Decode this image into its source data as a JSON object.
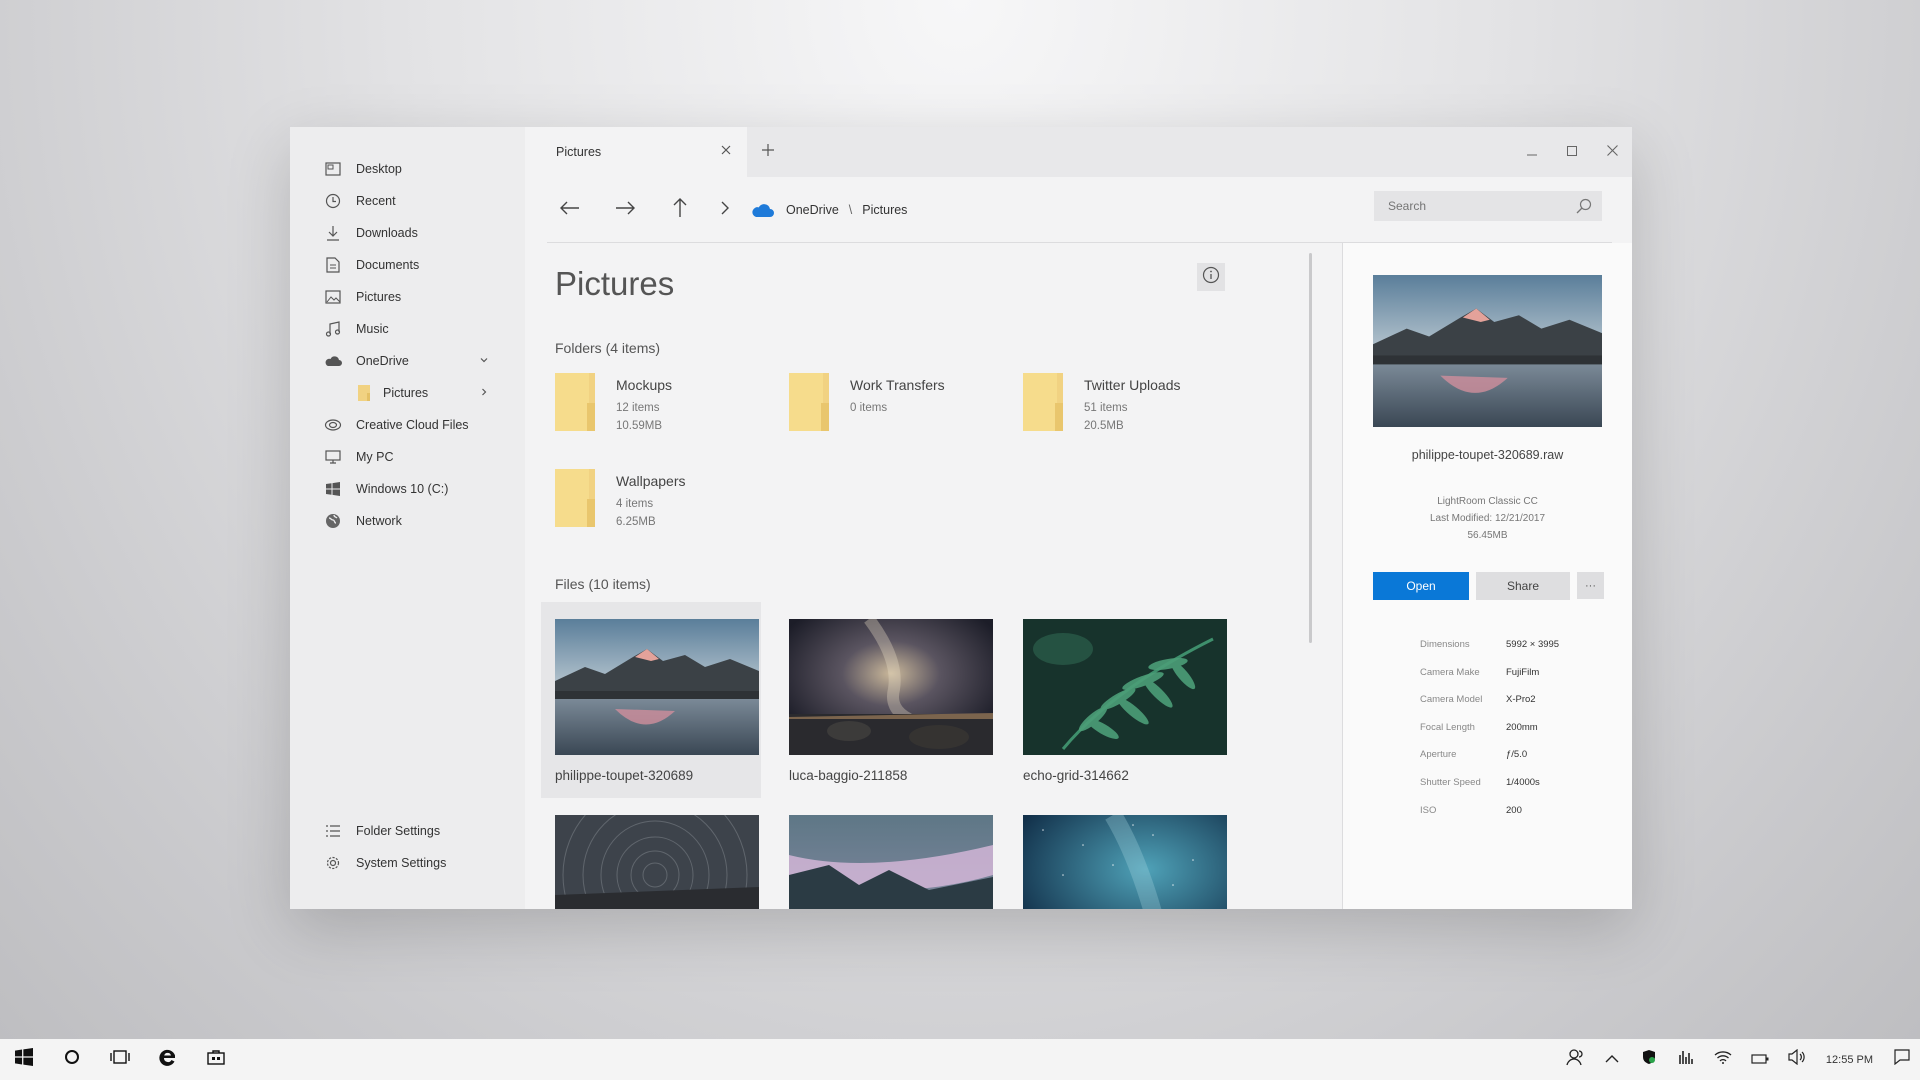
{
  "sidebar": {
    "items": [
      {
        "label": "Desktop",
        "icon": "desktop-icon"
      },
      {
        "label": "Recent",
        "icon": "clock-icon"
      },
      {
        "label": "Downloads",
        "icon": "download-icon"
      },
      {
        "label": "Documents",
        "icon": "document-icon"
      },
      {
        "label": "Pictures",
        "icon": "image-icon"
      },
      {
        "label": "Music",
        "icon": "music-note-icon"
      },
      {
        "label": "OneDrive",
        "icon": "cloud-icon"
      },
      {
        "label": "Pictures",
        "icon": "folder-icon"
      },
      {
        "label": "Creative Cloud Files",
        "icon": "creative-cloud-icon"
      },
      {
        "label": "My PC",
        "icon": "monitor-icon"
      },
      {
        "label": "Windows 10 (C:)",
        "icon": "windows-logo-icon"
      },
      {
        "label": "Network",
        "icon": "globe-icon"
      }
    ],
    "bottom": [
      {
        "label": "Folder Settings",
        "icon": "list-settings-icon"
      },
      {
        "label": "System Settings",
        "icon": "gear-icon"
      }
    ]
  },
  "tabs": [
    {
      "label": "Pictures"
    }
  ],
  "breadcrumb": {
    "root": "OneDrive",
    "separator": "\\",
    "current": "Pictures"
  },
  "search": {
    "placeholder": "Search"
  },
  "page": {
    "title": "Pictures"
  },
  "folders_section": {
    "label": "Folders (4 items)"
  },
  "folders": [
    {
      "name": "Mockups",
      "count": "12 items",
      "size": "10.59MB"
    },
    {
      "name": "Work Transfers",
      "count": "0 items",
      "size": ""
    },
    {
      "name": "Twitter Uploads",
      "count": "51 items",
      "size": "20.5MB"
    },
    {
      "name": "Wallpapers",
      "count": "4 items",
      "size": "6.25MB"
    }
  ],
  "files_section": {
    "label": "Files (10 items)"
  },
  "files": [
    {
      "name": "philippe-toupet-320689",
      "selected": true
    },
    {
      "name": "luca-baggio-211858",
      "selected": false
    },
    {
      "name": "echo-grid-314662",
      "selected": false
    },
    {
      "name": "",
      "selected": false
    },
    {
      "name": "",
      "selected": false
    },
    {
      "name": "",
      "selected": false
    }
  ],
  "details": {
    "filename": "philippe-toupet-320689.raw",
    "app": "LightRoom Classic CC",
    "modified": "Last Modified: 12/21/2017",
    "size": "56.45MB",
    "open_label": "Open",
    "share_label": "Share",
    "more_label": "···",
    "properties": [
      {
        "key": "Dimensions",
        "value": "5992 × 3995"
      },
      {
        "key": "Camera Make",
        "value": "FujiFilm"
      },
      {
        "key": "Camera Model",
        "value": "X-Pro2"
      },
      {
        "key": "Focal Length",
        "value": "200mm"
      },
      {
        "key": "Aperture",
        "value": "ƒ/5.0"
      },
      {
        "key": "Shutter Speed",
        "value": "1/4000s"
      },
      {
        "key": "ISO",
        "value": "200"
      }
    ]
  },
  "taskbar": {
    "time": "12:55 PM",
    "accent": "#0a78d7"
  }
}
